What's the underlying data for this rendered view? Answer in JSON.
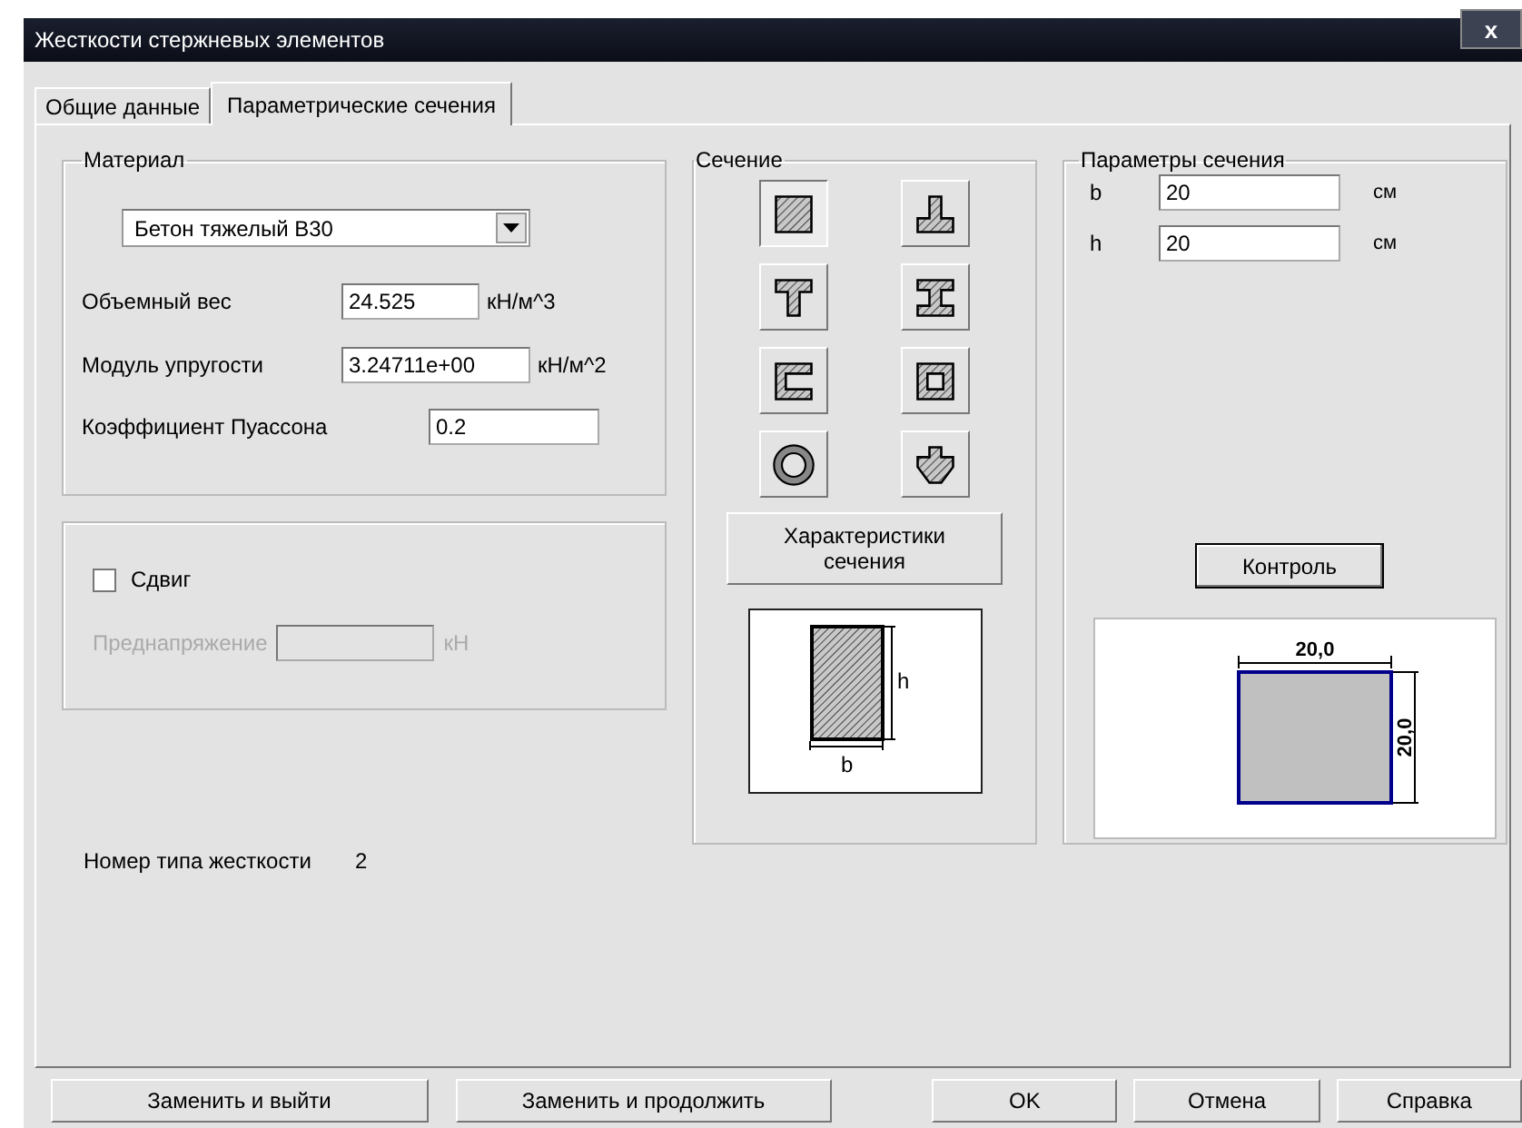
{
  "window": {
    "title": "Жесткости стержневых элементов",
    "close": "x"
  },
  "tabs": [
    {
      "label": "Общие данные",
      "selected": false
    },
    {
      "label": "Параметрические сечения",
      "selected": true
    }
  ],
  "material": {
    "title": "Материал",
    "material_value": "Бетон тяжелый В30",
    "fields": [
      {
        "label": "Объемный вес",
        "value": "24.525",
        "unit": "кН/м^3"
      },
      {
        "label": "Модуль упругости",
        "value": "3.24711e+00",
        "unit": "кН/м^2"
      },
      {
        "label": "Коэффициент Пуассона",
        "value": "0.2"
      }
    ]
  },
  "shear": {
    "label": "Сдвиг",
    "checked": false,
    "prestress_label": "Преднапряжение",
    "prestress_unit": "кН",
    "prestress_disabled": true
  },
  "stiffness_type": {
    "label": "Номер типа жесткости",
    "value": "2"
  },
  "section": {
    "title": "Сечение",
    "types": [
      {
        "kind": "rectangle",
        "selected": true
      },
      {
        "kind": "inverted-tee",
        "selected": false
      },
      {
        "kind": "tee",
        "selected": false
      },
      {
        "kind": "i-beam",
        "selected": false
      },
      {
        "kind": "channel",
        "selected": false
      },
      {
        "kind": "box",
        "selected": false
      },
      {
        "kind": "ring",
        "selected": false
      },
      {
        "kind": "cross",
        "selected": false
      }
    ],
    "characteristics_button": "Характеристики сечения",
    "sketch_b": "b",
    "sketch_h": "h"
  },
  "parameters": {
    "title": "Параметры сечения",
    "fields": [
      {
        "label": "b",
        "value": "20",
        "unit": "см"
      },
      {
        "label": "h",
        "value": "20",
        "unit": "см"
      }
    ],
    "control_button": "Контроль",
    "width_label": "20,0",
    "height_label": "20,0"
  },
  "buttons": [
    {
      "label": "Заменить и выйти",
      "kind": "wide"
    },
    {
      "label": "Заменить и продолжить",
      "kind": "wide"
    },
    {
      "label": "OK",
      "kind": "narrow"
    },
    {
      "label": "Отмена",
      "kind": "narrow"
    },
    {
      "label": "Справка",
      "kind": "narrow"
    }
  ]
}
